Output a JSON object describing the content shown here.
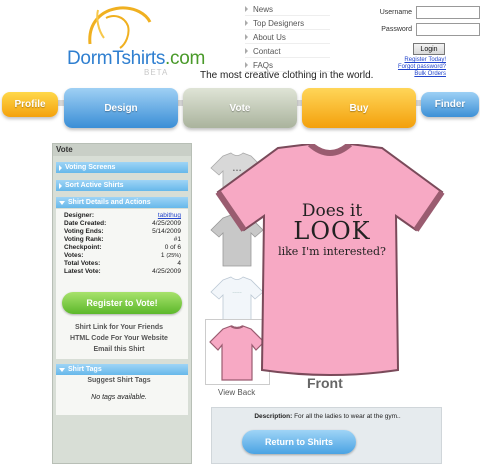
{
  "header": {
    "logo_text": "DormTshirts",
    "logo_suffix": ".com",
    "logo_badge": "BETA",
    "tagline": "The most creative clothing in the world."
  },
  "topnav": {
    "items": [
      "News",
      "Top Designers",
      "About Us",
      "Contact",
      "FAQs"
    ]
  },
  "login": {
    "username_label": "Username",
    "password_label": "Password",
    "login_button": "Login",
    "register_link": "Register Today!",
    "forgot_link": "Forgot password?",
    "bulk_link": "Bulk Orders"
  },
  "mainnav": {
    "profile": "Profile",
    "design": "Design",
    "vote": "Vote",
    "buy": "Buy",
    "finder": "Finder"
  },
  "sidebar": {
    "title": "Vote",
    "voting_screens": "Voting Screens",
    "sort_active": "Sort Active Shirts",
    "details_header": "Shirt Details and Actions",
    "details": [
      {
        "label": "Designer:",
        "value": "tabithug",
        "link": true
      },
      {
        "label": "Date Created:",
        "value": "4/25/2009"
      },
      {
        "label": "Voting Ends:",
        "value": "5/14/2009"
      },
      {
        "label": "Voting Rank:",
        "value": "#1"
      },
      {
        "label": "Checkpoint:",
        "value": "0 of 6"
      },
      {
        "label": "Votes:",
        "value": "1",
        "extra": "(25%)"
      },
      {
        "label": "Total Votes:",
        "value": "4"
      },
      {
        "label": "Latest Vote:",
        "value": "4/25/2009"
      }
    ],
    "register_button": "Register to Vote!",
    "link_friends": "Shirt Link for Your Friends",
    "html_code": "HTML Code For Your Website",
    "email_shirt": "Email this Shirt",
    "tags_header": "Shirt Tags",
    "suggest_tags": "Suggest Shirt Tags",
    "no_tags": "No tags available."
  },
  "shirt": {
    "text_line1": "Does it",
    "text_line2": "LOOK",
    "text_line3": "like I'm interested?",
    "view_back": "View Back",
    "front_label": "Front",
    "description_label": "Description:",
    "description": "For all the ladies to wear at the gym..",
    "return_button": "Return to Shirts",
    "colors": {
      "body": "#f7a9c4",
      "trim": "#9a5c70",
      "text": "#222222"
    }
  }
}
